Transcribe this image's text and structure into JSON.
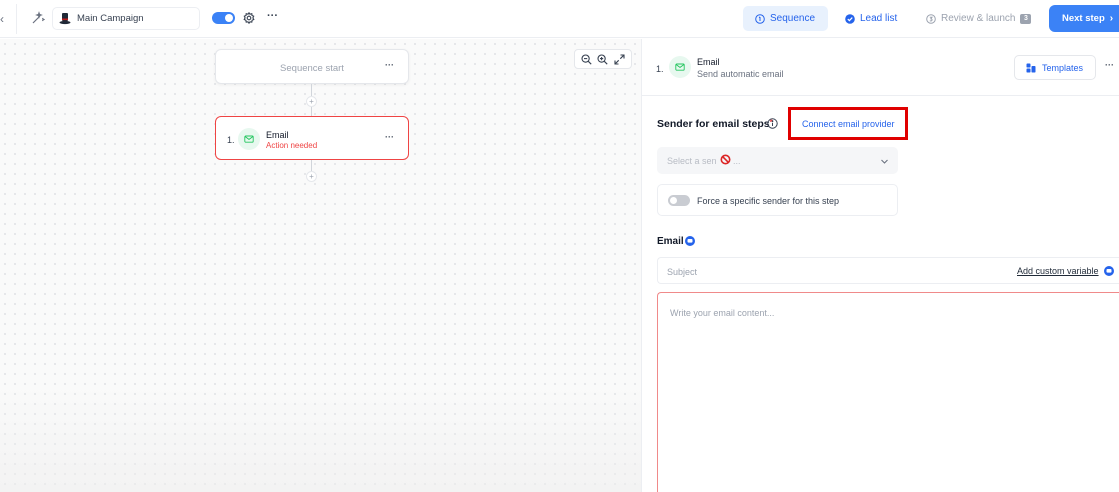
{
  "topbar": {
    "campaign_name": "Main Campaign",
    "tabs": [
      {
        "label": "Sequence"
      },
      {
        "label": "Lead list"
      },
      {
        "label": "Review & launch",
        "badge": "3"
      }
    ],
    "next_label": "Next step"
  },
  "canvas": {
    "start_label": "Sequence start",
    "plus": "+",
    "node": {
      "number": "1.",
      "title": "Email",
      "status": "Action needed"
    }
  },
  "panel": {
    "step_number": "1.",
    "step_title": "Email",
    "step_subtitle": "Send automatic email",
    "templates_label": "Templates",
    "sender_label": "Sender for email steps",
    "required_mark": "*",
    "connect_link": "Connect email provider",
    "sender_placeholder_start": "Select a sen",
    "sender_placeholder_end": "...",
    "force_label": "Force a specific sender for this step",
    "email_label": "Email",
    "subject_placeholder": "Subject",
    "add_variable": "Add custom variable",
    "content_placeholder": "Write your email content..."
  },
  "icons": {
    "back": "chevron-left-icon",
    "wand": "magic-wand-icon",
    "hat": "top-hat-icon",
    "gear": "gear-icon",
    "mail": "mail-icon",
    "zoom_out": "zoom-out-icon",
    "zoom_in": "zoom-in-icon",
    "expand": "expand-icon",
    "templates": "templates-icon",
    "info": "info-icon",
    "no_entry": "no-entry-icon",
    "chevron_down": "chevron-down-icon"
  },
  "colors": {
    "primary": "#3b82f6",
    "link": "#2563eb",
    "error": "#ef4444",
    "highlight_box": "#e00000",
    "mail_bg": "#e7f8ef",
    "mail_icon": "#22c55e"
  }
}
